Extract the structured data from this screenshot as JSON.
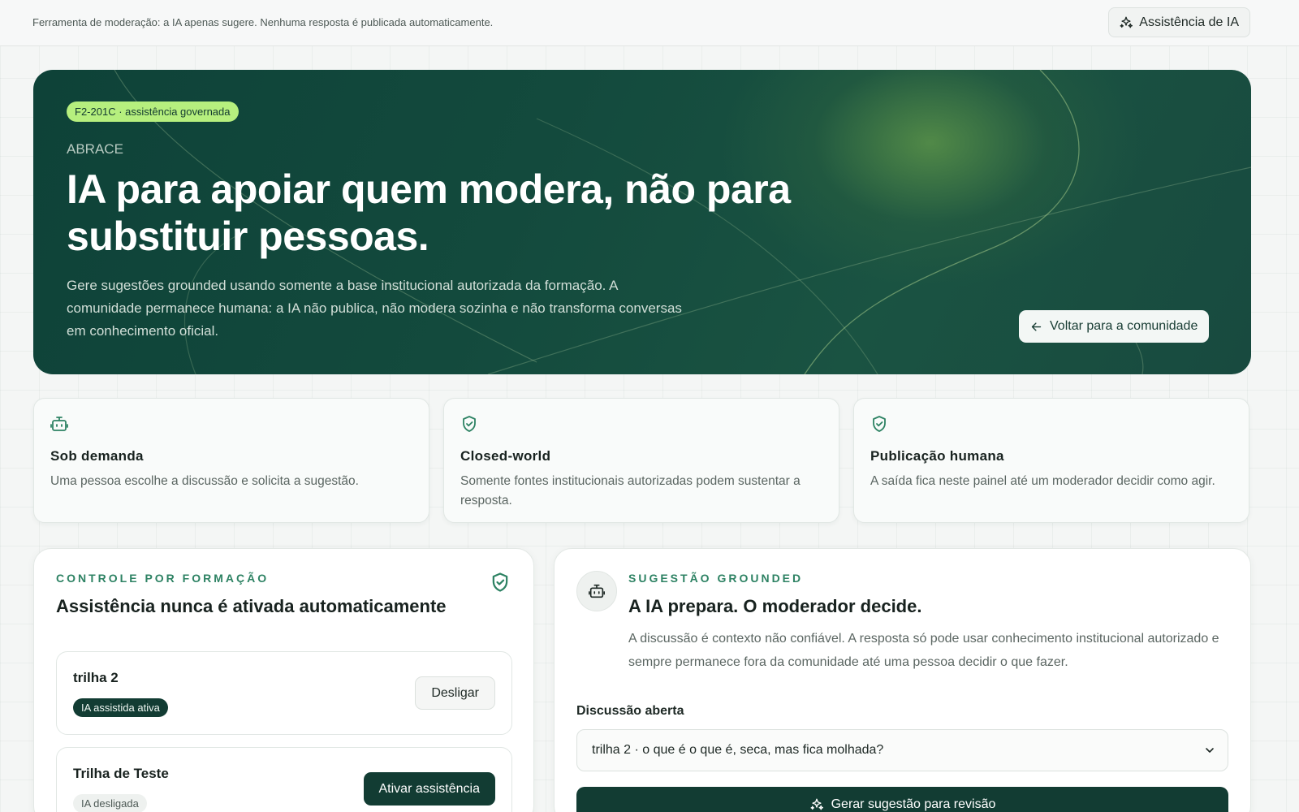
{
  "topbar": {
    "notice": "Ferramenta de moderação: a IA apenas sugere. Nenhuma resposta é publicada automaticamente.",
    "ai_button_label": "Assistência de IA",
    "ai_button_icon": "sparkles-icon"
  },
  "hero": {
    "tag": "F2-201C · assistência governada",
    "eyebrow": "ABRACE",
    "title": "IA para apoiar quem modera, não para substituir pessoas.",
    "description": "Gere sugestões grounded usando somente a base institucional autorizada da formação. A comunidade permanece humana: a IA não publica, não modera sozinha e não transforma conversas em conhecimento oficial.",
    "back_button_label": "Voltar para a comunidade",
    "back_button_icon": "arrow-left-icon"
  },
  "features": [
    {
      "icon": "bot-icon",
      "title": "Sob demanda",
      "description": "Uma pessoa escolhe a discussão e solicita a sugestão."
    },
    {
      "icon": "shield-check-icon",
      "title": "Closed-world",
      "description": "Somente fontes institucionais autorizadas podem sustentar a resposta."
    },
    {
      "icon": "shield-check-icon",
      "title": "Publicação humana",
      "description": "A saída fica neste painel até um moderador decidir como agir."
    }
  ],
  "control_panel": {
    "eyebrow": "CONTROLE POR FORMAÇÃO",
    "title": "Assistência nunca é ativada automaticamente",
    "tracks": [
      {
        "name": "trilha 2",
        "status": "IA assistida ativa",
        "action": "Desligar"
      },
      {
        "name": "Trilha de Teste",
        "status": "IA desligada",
        "action": "Ativar assistência"
      }
    ]
  },
  "suggestion_panel": {
    "eyebrow": "SUGESTÃO GROUNDED",
    "title": "A IA prepara. O moderador decide.",
    "description": "A discussão é contexto não confiável. A resposta só pode usar conhecimento institucional autorizado e sempre permanece fora da comunidade até uma pessoa decidir o que fazer.",
    "field_label": "Discussão aberta",
    "selected_discussion": "trilha 2 · o que é o que é, seca, mas fica molhada?",
    "generate_button_label": "Gerar sugestão para revisão"
  },
  "colors": {
    "brand_dark": "#123c33",
    "accent_green": "#2d8263",
    "tag_lime": "#b6ef7e"
  }
}
